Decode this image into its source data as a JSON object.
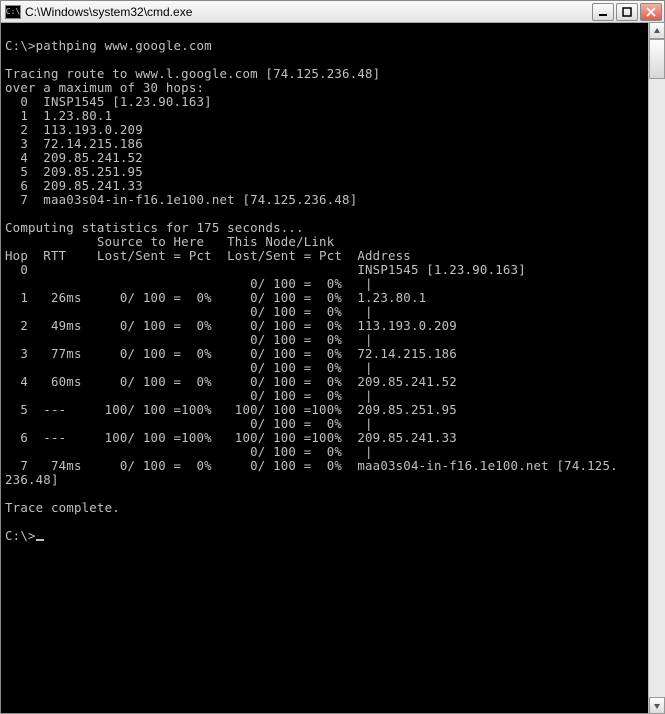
{
  "window": {
    "title": "C:\\Windows\\system32\\cmd.exe",
    "icon_glyph": "C:\\"
  },
  "prompt": "C:\\>",
  "command": "pathping www.google.com",
  "blank": "",
  "trace_header": "Tracing route to www.l.google.com [74.125.236.48]",
  "trace_sub": "over a maximum of 30 hops:",
  "route": [
    "  0  INSP1545 [1.23.90.163]",
    "  1  1.23.80.1",
    "  2  113.193.0.209",
    "  3  72.14.215.186",
    "  4  209.85.241.52",
    "  5  209.85.251.95",
    "  6  209.85.241.33",
    "  7  maa03s04-in-f16.1e100.net [74.125.236.48]"
  ],
  "stats_header": "Computing statistics for 175 seconds...",
  "col1": "            Source to Here   This Node/Link",
  "col2": "Hop  RTT    Lost/Sent = Pct  Lost/Sent = Pct  Address",
  "rows": [
    "  0                                           INSP1545 [1.23.90.163]",
    "                                0/ 100 =  0%   |",
    "  1   26ms     0/ 100 =  0%     0/ 100 =  0%  1.23.80.1",
    "                                0/ 100 =  0%   |",
    "  2   49ms     0/ 100 =  0%     0/ 100 =  0%  113.193.0.209",
    "                                0/ 100 =  0%   |",
    "  3   77ms     0/ 100 =  0%     0/ 100 =  0%  72.14.215.186",
    "                                0/ 100 =  0%   |",
    "  4   60ms     0/ 100 =  0%     0/ 100 =  0%  209.85.241.52",
    "                                0/ 100 =  0%   |",
    "  5  ---     100/ 100 =100%   100/ 100 =100%  209.85.251.95",
    "                                0/ 100 =  0%   |",
    "  6  ---     100/ 100 =100%   100/ 100 =100%  209.85.241.33",
    "                                0/ 100 =  0%   |",
    "  7   74ms     0/ 100 =  0%     0/ 100 =  0%  maa03s04-in-f16.1e100.net [74.125.",
    "236.48]"
  ],
  "complete": "Trace complete.",
  "final_prompt": "C:\\>"
}
